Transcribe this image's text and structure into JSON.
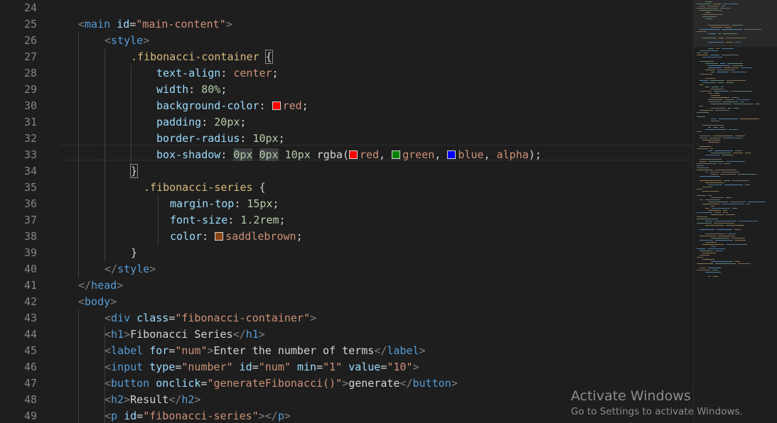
{
  "editor": {
    "line_numbers": [
      "24",
      "25",
      "26",
      "27",
      "28",
      "29",
      "30",
      "31",
      "32",
      "33",
      "34",
      "35",
      "36",
      "37",
      "38",
      "39",
      "40",
      "41",
      "42",
      "43",
      "44",
      "45",
      "46",
      "47",
      "48",
      "49"
    ],
    "line25": {
      "tag": "main",
      "attr": "id",
      "value": "\"main-content\""
    },
    "line26": {
      "tag": "style"
    },
    "line27": {
      "selector": ".fibonacci-container"
    },
    "line28": {
      "prop": "text-align",
      "value": "center"
    },
    "line29": {
      "prop": "width",
      "value": "80%"
    },
    "line30": {
      "prop": "background-color",
      "value": "red",
      "swatch": "#ff0000"
    },
    "line31": {
      "prop": "padding",
      "value": "20px"
    },
    "line32": {
      "prop": "border-radius",
      "value": "10px"
    },
    "line33": {
      "prop": "box-shadow",
      "v1": "0px",
      "v2": "0px",
      "v3": "10px",
      "fn": "rgba",
      "c1": "red",
      "c1_swatch": "#ff0000",
      "c2": "green",
      "c2_swatch": "#008000",
      "c3": "blue",
      "c3_swatch": "#0000ff",
      "c4": "alpha"
    },
    "line35": {
      "selector": ".fibonacci-series"
    },
    "line36": {
      "prop": "margin-top",
      "value": "15px"
    },
    "line37": {
      "prop": "font-size",
      "value": "1.2rem"
    },
    "line38": {
      "prop": "color",
      "value": "saddlebrown",
      "swatch": "#8b4513"
    },
    "line40": {
      "tag": "style"
    },
    "line41": {
      "tag": "head"
    },
    "line42": {
      "tag": "body"
    },
    "line43": {
      "tag": "div",
      "attr": "class",
      "value": "\"fibonacci-container\""
    },
    "line44": {
      "tag": "h1",
      "text": "Fibonacci Series"
    },
    "line45": {
      "tag": "label",
      "attr": "for",
      "value": "\"num\"",
      "text": "Enter the number of terms"
    },
    "line46": {
      "tag": "input",
      "a1": "type",
      "v1": "\"number\"",
      "a2": "id",
      "v2": "\"num\"",
      "a3": "min",
      "v3": "\"1\"",
      "a4": "value",
      "v4": "\"10\""
    },
    "line47": {
      "tag": "button",
      "attr": "onclick",
      "value": "\"generateFibonacci()\"",
      "text": "generate"
    },
    "line48": {
      "tag": "h2",
      "text": "Result"
    },
    "line49": {
      "tag": "p",
      "attr": "id",
      "value": "\"fibonacci-series\""
    }
  },
  "watermark": {
    "title": "Activate Windows",
    "subtitle": "Go to Settings to activate Windows."
  }
}
